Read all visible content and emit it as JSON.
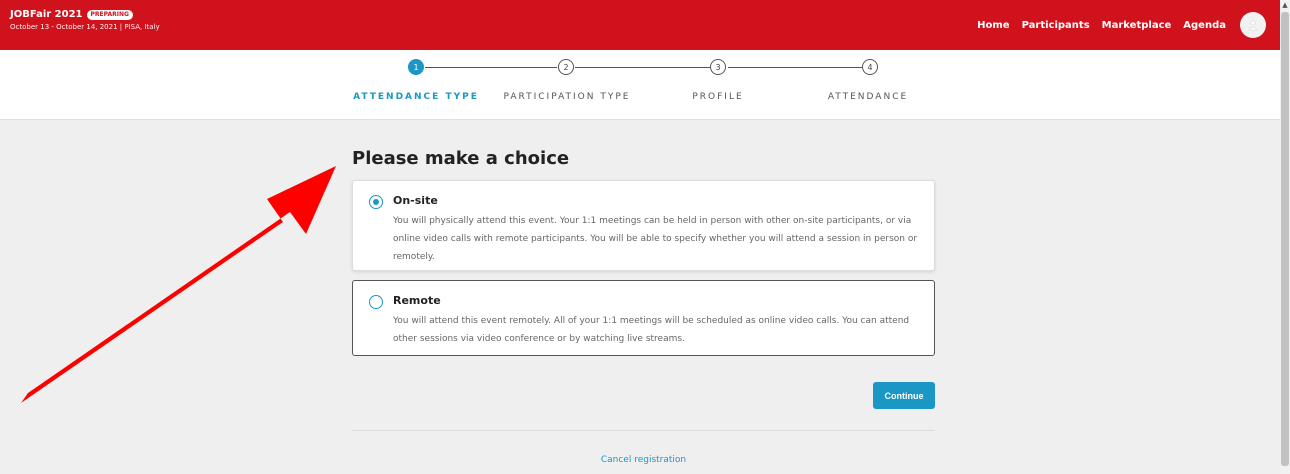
{
  "header": {
    "title": "JOBFair 2021",
    "badge": "PREPARING",
    "subtitle": "October 13 - October 14, 2021 | PISA, Italy",
    "nav": [
      "Home",
      "Participants",
      "Marketplace",
      "Agenda"
    ],
    "brand_color": "#d0121d"
  },
  "stepper": {
    "steps": [
      {
        "number": "1",
        "label": "ATTENDANCE TYPE",
        "active": true
      },
      {
        "number": "2",
        "label": "PARTICIPATION TYPE",
        "active": false
      },
      {
        "number": "3",
        "label": "PROFILE",
        "active": false
      },
      {
        "number": "4",
        "label": "ATTENDANCE",
        "active": false
      }
    ],
    "accent_color": "#1a97c4"
  },
  "main": {
    "title": "Please make a choice",
    "options": [
      {
        "title": "On-site",
        "description": "You will physically attend this event. Your 1:1 meetings can be held in person with other on-site participants, or via online video calls with remote participants. You will be able to specify whether you will attend a session in person or remotely.",
        "selected": true
      },
      {
        "title": "Remote",
        "description": "You will attend this event remotely. All of your 1:1 meetings will be scheduled as online video calls. You can attend other sessions via video conference or by watching live streams.",
        "selected": false
      }
    ],
    "continue_label": "Continue",
    "cancel_label": "Cancel registration"
  },
  "annotation": {
    "arrow_color": "#ff0000"
  }
}
